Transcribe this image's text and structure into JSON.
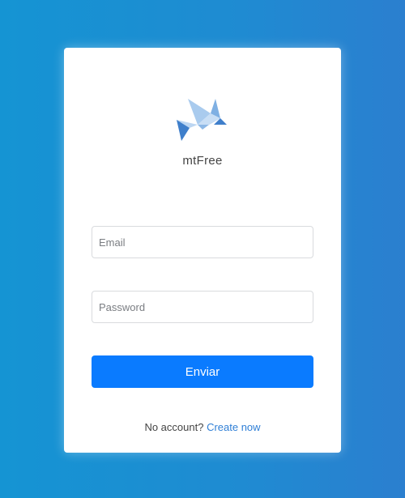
{
  "app": {
    "brand_name": "mtFree"
  },
  "form": {
    "email_placeholder": "Email",
    "email_value": "",
    "password_placeholder": "Password",
    "password_value": "",
    "submit_label": "Enviar"
  },
  "footer": {
    "prompt_text": "No account?",
    "link_text": "Create now"
  },
  "icons": {
    "logo": "origami-bird-icon"
  },
  "colors": {
    "background_start": "#1594d3",
    "background_end": "#2b7fcf",
    "button": "#0a7bff",
    "link": "#2f7fd6",
    "logo_light": "#a9cbee",
    "logo_dark": "#3f7fcb"
  }
}
